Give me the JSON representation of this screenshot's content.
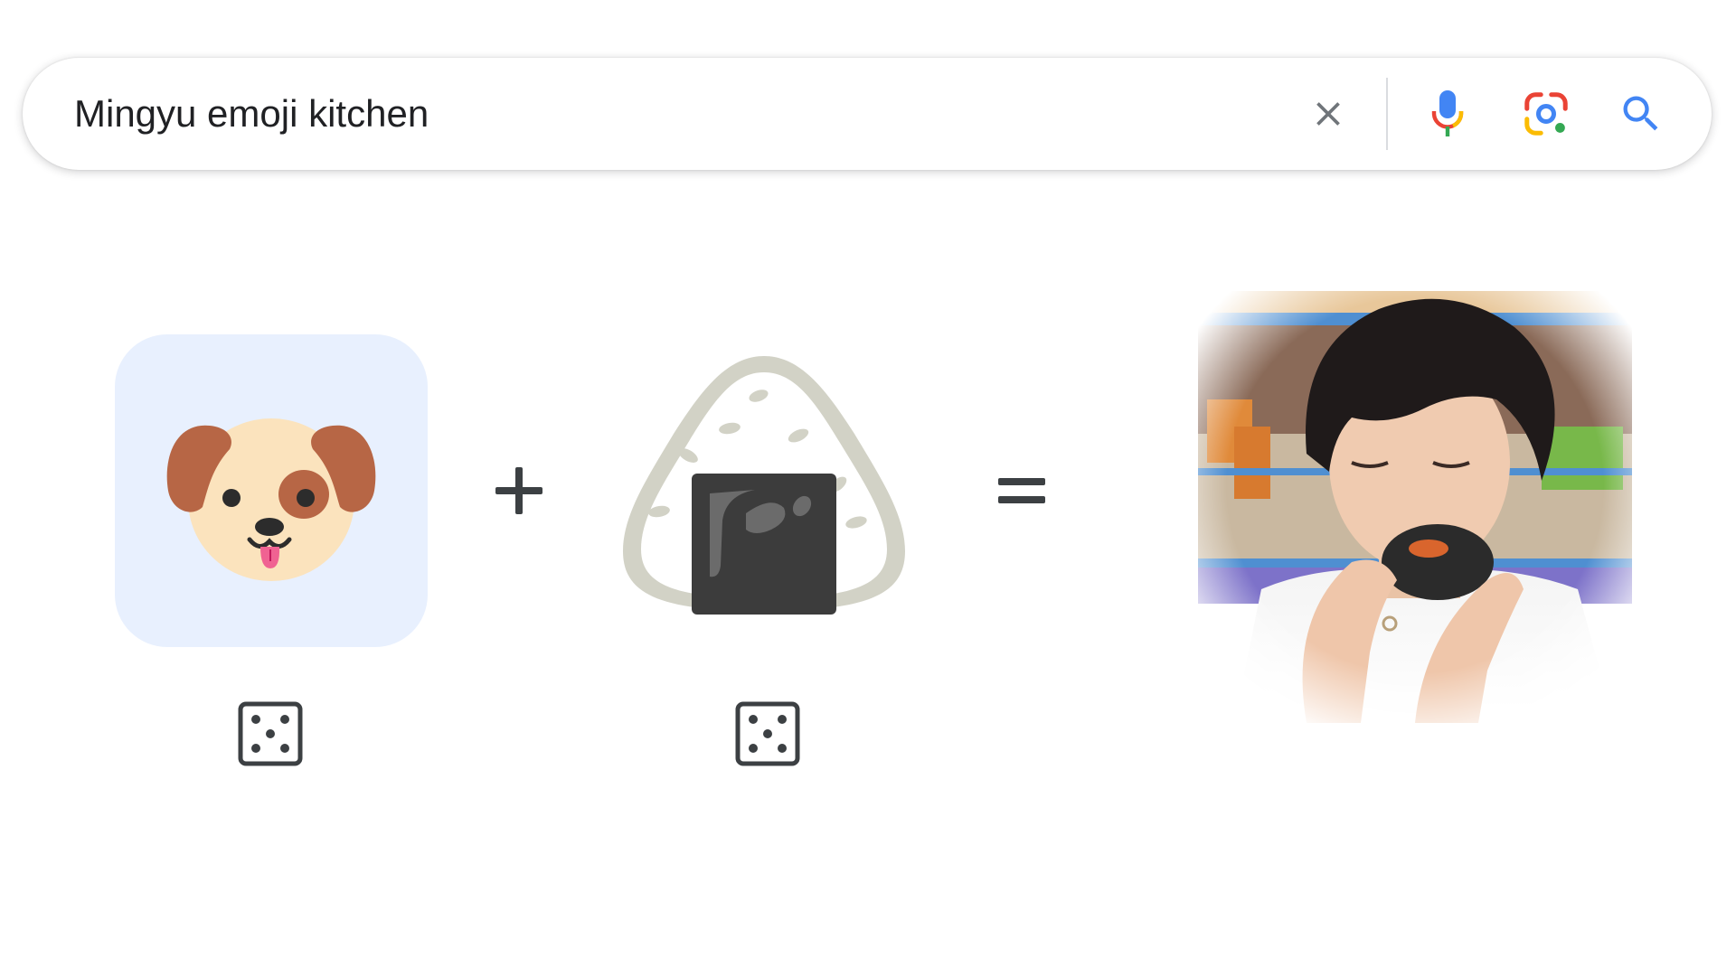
{
  "search": {
    "query": "Mingyu emoji kitchen",
    "icons": {
      "clear": "close-icon",
      "voice": "microphone-icon",
      "lens": "google-lens-icon",
      "search": "search-icon"
    },
    "colors": {
      "blue": "#4285f4",
      "red": "#ea4335",
      "yellow": "#fbbc04",
      "green": "#34a853",
      "text": "#202124",
      "clear_icon": "#70757a"
    }
  },
  "kitchen": {
    "first_emoji": "dog-face",
    "operator_plus": "+",
    "second_emoji": "rice-ball",
    "operator_equals": "=",
    "randomize_icon": "dice-icon",
    "result": "photo of person eating a rice ball in a store",
    "tile_color": "#e8f0fe"
  }
}
